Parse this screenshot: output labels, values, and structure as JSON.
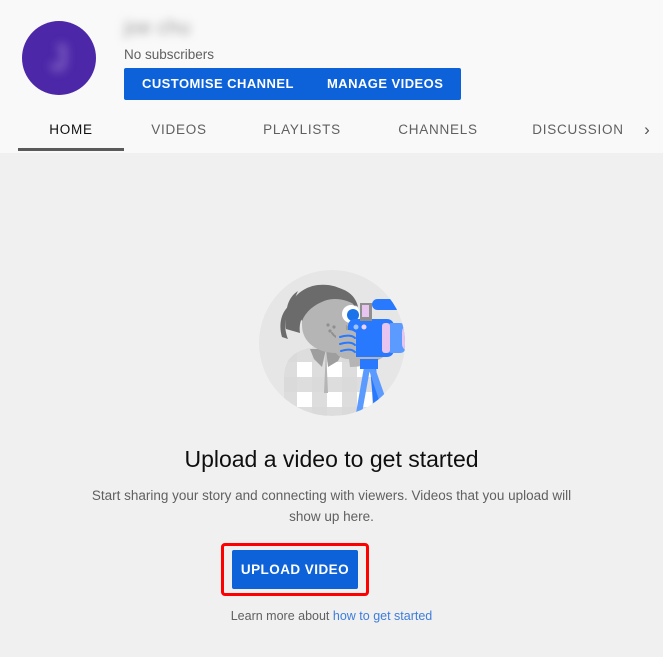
{
  "channel": {
    "name": "joe chu",
    "name_redacted": true,
    "avatar_initial": "J",
    "avatar_color": "#4c27a8",
    "subscriber_count": "No subscribers",
    "buttons": {
      "customise": "CUSTOMISE CHANNEL",
      "manage": "MANAGE VIDEOS"
    }
  },
  "tabs": {
    "items": [
      {
        "label": "HOME",
        "active": true
      },
      {
        "label": "VIDEOS",
        "active": false
      },
      {
        "label": "PLAYLISTS",
        "active": false
      },
      {
        "label": "CHANNELS",
        "active": false
      },
      {
        "label": "DISCUSSION",
        "active": false
      }
    ],
    "next_arrow": "›"
  },
  "empty_state": {
    "title": "Upload a video to get started",
    "description": "Start sharing your story and connecting with viewers. Videos that you upload will show up here.",
    "upload_button": "UPLOAD VIDEO",
    "learn_more_prefix": "Learn more about ",
    "learn_more_link": "how to get started"
  },
  "colors": {
    "accent_blue": "#0d62d9",
    "link_blue": "#3d7ddb",
    "highlight_red": "#ff0000",
    "header_background": "#f9f9f9",
    "page_background": "#f0f0f0",
    "tab_active_underline": "#5a5a5a"
  }
}
